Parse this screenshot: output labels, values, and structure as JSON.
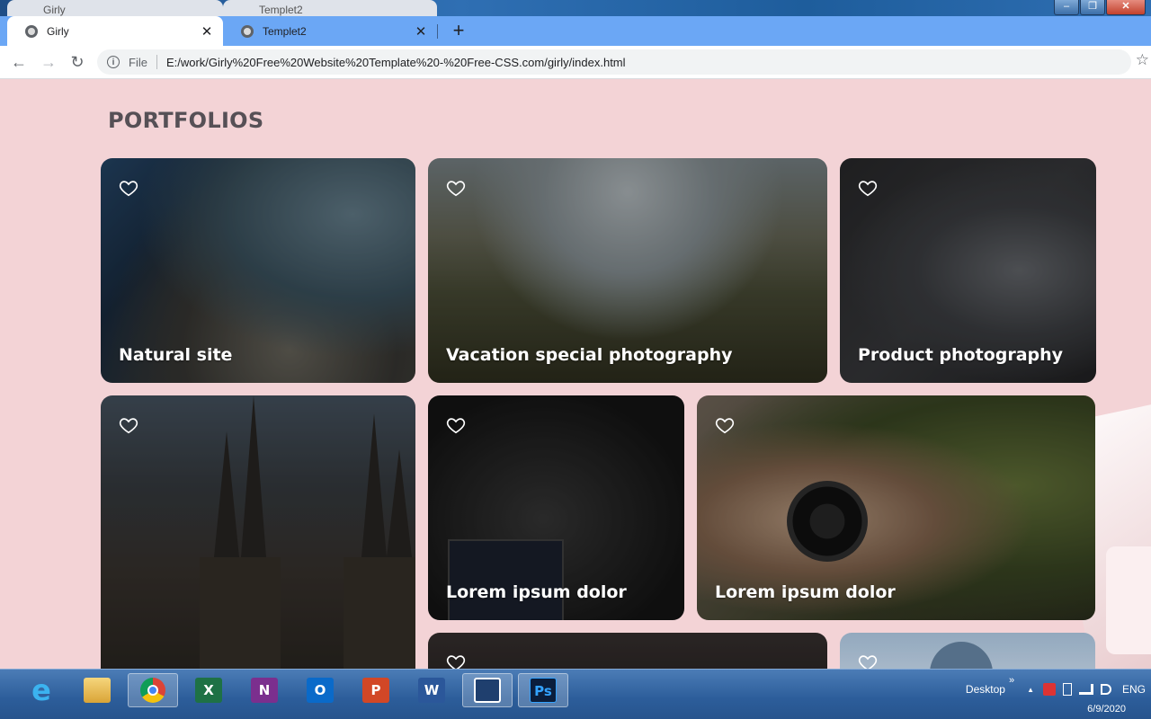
{
  "window": {
    "minimize_glyph": "‒",
    "maximize_glyph": "❐",
    "close_glyph": "✕"
  },
  "ghost_tabs": [
    {
      "label": "Girly"
    },
    {
      "label": "Templet2"
    }
  ],
  "browser": {
    "tabs": [
      {
        "label": "Girly",
        "active": true
      },
      {
        "label": "Templet2",
        "active": false
      }
    ],
    "new_tab_glyph": "+",
    "close_glyph": "✕",
    "nav": {
      "back": "←",
      "forward": "→",
      "reload": "↻"
    },
    "address": {
      "info_glyph": "i",
      "scheme": "File",
      "url": "E:/work/Girly%20Free%20Website%20Template%20-%20Free-CSS.com/girly/index.html"
    },
    "bookmark_glyph": "☆"
  },
  "page": {
    "heading": "PORTFOLIOS",
    "cards": [
      {
        "title": "Natural site",
        "icon": "heart-outline-icon"
      },
      {
        "title": "Vacation special photography",
        "icon": "heart-outline-icon"
      },
      {
        "title": "Product photography",
        "icon": "heart-outline-icon"
      },
      {
        "title": "",
        "icon": "heart-outline-icon"
      },
      {
        "title": "Lorem ipsum dolor",
        "icon": "heart-outline-icon"
      },
      {
        "title": "Lorem ipsum dolor",
        "icon": "heart-outline-icon"
      },
      {
        "title": "",
        "icon": "heart-outline-icon"
      },
      {
        "title": "",
        "icon": "heart-outline-icon"
      }
    ]
  },
  "taskbar": {
    "apps": [
      {
        "name": "internet-explorer",
        "glyph": "e"
      },
      {
        "name": "file-explorer",
        "glyph": ""
      },
      {
        "name": "google-chrome",
        "glyph": ""
      },
      {
        "name": "microsoft-excel",
        "glyph": "X"
      },
      {
        "name": "microsoft-onenote",
        "glyph": "N"
      },
      {
        "name": "microsoft-outlook",
        "glyph": "O"
      },
      {
        "name": "microsoft-powerpoint",
        "glyph": "P"
      },
      {
        "name": "microsoft-word",
        "glyph": "W"
      },
      {
        "name": "snipping-tool",
        "glyph": ""
      },
      {
        "name": "adobe-photoshop",
        "glyph": "Ps"
      }
    ],
    "desktop_label": "Desktop",
    "chevron": "»",
    "tray_up": "▲",
    "language": "ENG",
    "date": "6/9/2020"
  },
  "colors": {
    "page_background": "#f3d3d6",
    "heading": "#565056",
    "tabstrip": "#6ba7f5"
  }
}
